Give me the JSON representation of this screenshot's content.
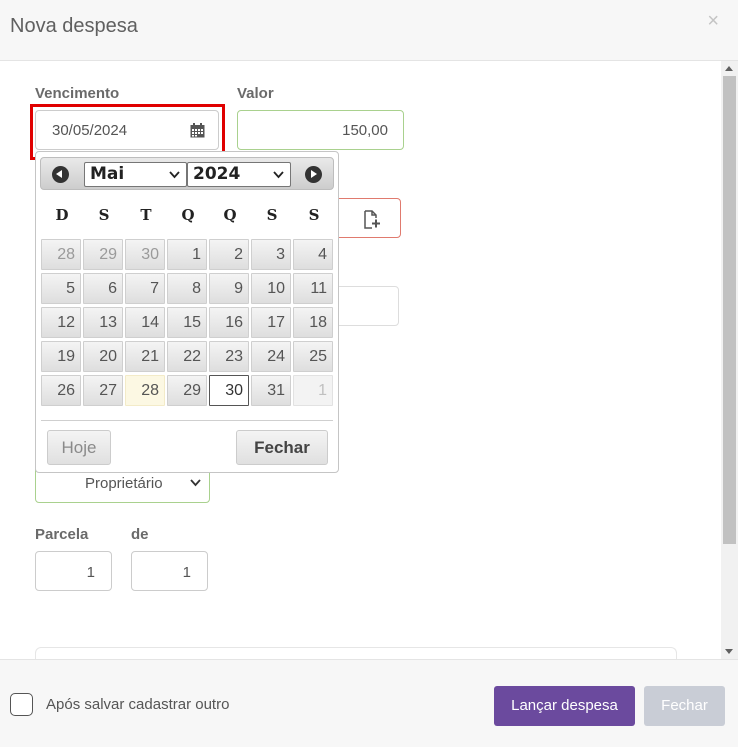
{
  "modal": {
    "title": "Nova despesa",
    "close_glyph": "×"
  },
  "form": {
    "vencimento_label": "Vencimento",
    "vencimento_value": "30/05/2024",
    "valor_label": "Valor",
    "valor_value": "150,00",
    "tipo_value": "Proprietário",
    "parcela_label": "Parcela",
    "parcela_value": "1",
    "de_label": "de",
    "de_value": "1"
  },
  "datepicker": {
    "month": "Mai",
    "year": "2024",
    "weekdays": [
      "D",
      "S",
      "T",
      "Q",
      "Q",
      "S",
      "S"
    ],
    "weeks": [
      [
        "28",
        "29",
        "30",
        "1",
        "2",
        "3",
        "4"
      ],
      [
        "5",
        "6",
        "7",
        "8",
        "9",
        "10",
        "11"
      ],
      [
        "12",
        "13",
        "14",
        "15",
        "16",
        "17",
        "18"
      ],
      [
        "19",
        "20",
        "21",
        "22",
        "23",
        "24",
        "25"
      ],
      [
        "26",
        "27",
        "28",
        "29",
        "30",
        "31",
        "1"
      ]
    ],
    "today_label": "Hoje",
    "close_label": "Fechar"
  },
  "footer": {
    "checkbox_label": "Após salvar cadastrar outro",
    "submit_label": "Lançar despesa",
    "close_label": "Fechar"
  },
  "colors": {
    "primary": "#6b4a9e",
    "highlight": "#e00000",
    "valid_border": "#a9d18e",
    "error_border": "#e07a6e"
  },
  "icons": [
    "calendar-icon",
    "file-add-icon",
    "chevron-down-icon",
    "close-icon",
    "prev-month-icon",
    "next-month-icon"
  ]
}
